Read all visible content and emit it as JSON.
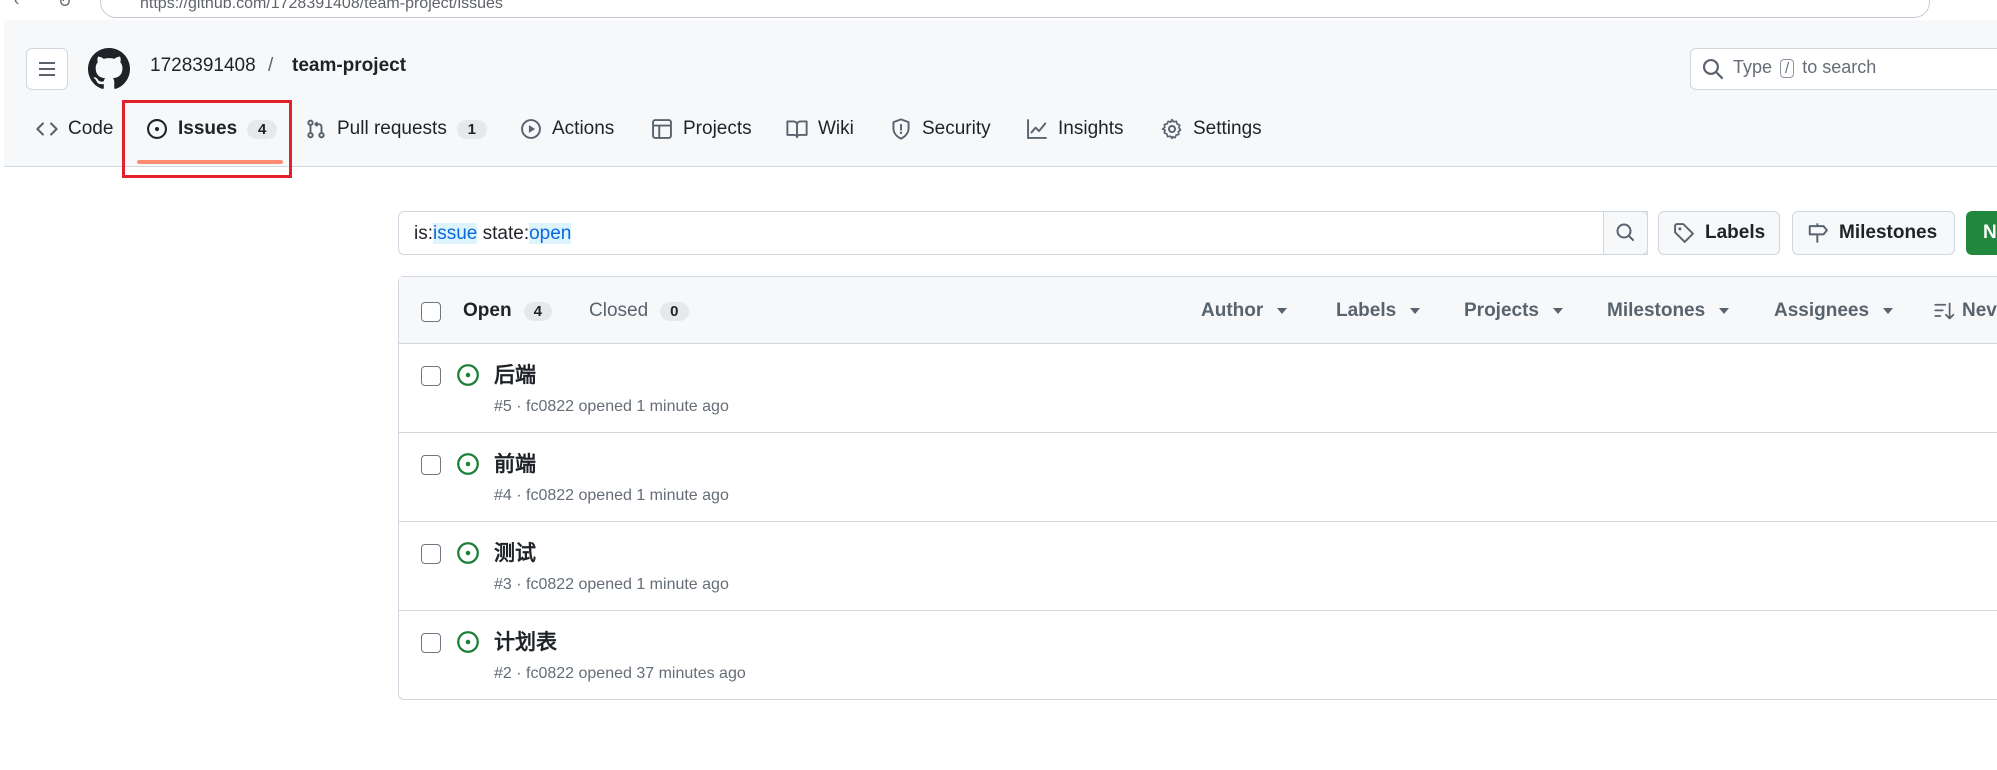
{
  "browser": {
    "url": "https://github.com/1728391408/team-project/issues"
  },
  "header": {
    "owner": "1728391408",
    "separator": "/",
    "repo": "team-project",
    "search_placeholder_pre": "Type",
    "search_key": "/",
    "search_placeholder_post": "to search"
  },
  "tabs": [
    {
      "label": "Code",
      "icon": "code-icon"
    },
    {
      "label": "Issues",
      "count": "4",
      "icon": "issue-opened-icon",
      "selected": true
    },
    {
      "label": "Pull requests",
      "count": "1",
      "icon": "git-pull-request-icon"
    },
    {
      "label": "Actions",
      "icon": "play-icon"
    },
    {
      "label": "Projects",
      "icon": "table-icon"
    },
    {
      "label": "Wiki",
      "icon": "book-icon"
    },
    {
      "label": "Security",
      "icon": "shield-icon"
    },
    {
      "label": "Insights",
      "icon": "graph-icon"
    },
    {
      "label": "Settings",
      "icon": "gear-icon"
    }
  ],
  "filter": {
    "prefix1": "is:",
    "value1": "issue",
    "prefix2": " state:",
    "value2": "open"
  },
  "buttons": {
    "labels": "Labels",
    "milestones": "Milestones",
    "new_issue": "N"
  },
  "list_header": {
    "open_label": "Open",
    "open_count": "4",
    "closed_label": "Closed",
    "closed_count": "0",
    "filters": [
      "Author",
      "Labels",
      "Projects",
      "Milestones",
      "Assignees"
    ],
    "sort_label": "Nev"
  },
  "issues": [
    {
      "title": "后端",
      "meta": "#5 · fc0822 opened 1 minute ago"
    },
    {
      "title": "前端",
      "meta": "#4 · fc0822 opened 1 minute ago"
    },
    {
      "title": "测试",
      "meta": "#3 · fc0822 opened 1 minute ago"
    },
    {
      "title": "计划表",
      "meta": "#2 · fc0822 opened 37 minutes ago"
    }
  ],
  "colors": {
    "accent_underline": "#fd8c73",
    "open_icon": "#1a7f37",
    "primary_button": "#1f883d",
    "highlight_box": "#e3212b"
  }
}
